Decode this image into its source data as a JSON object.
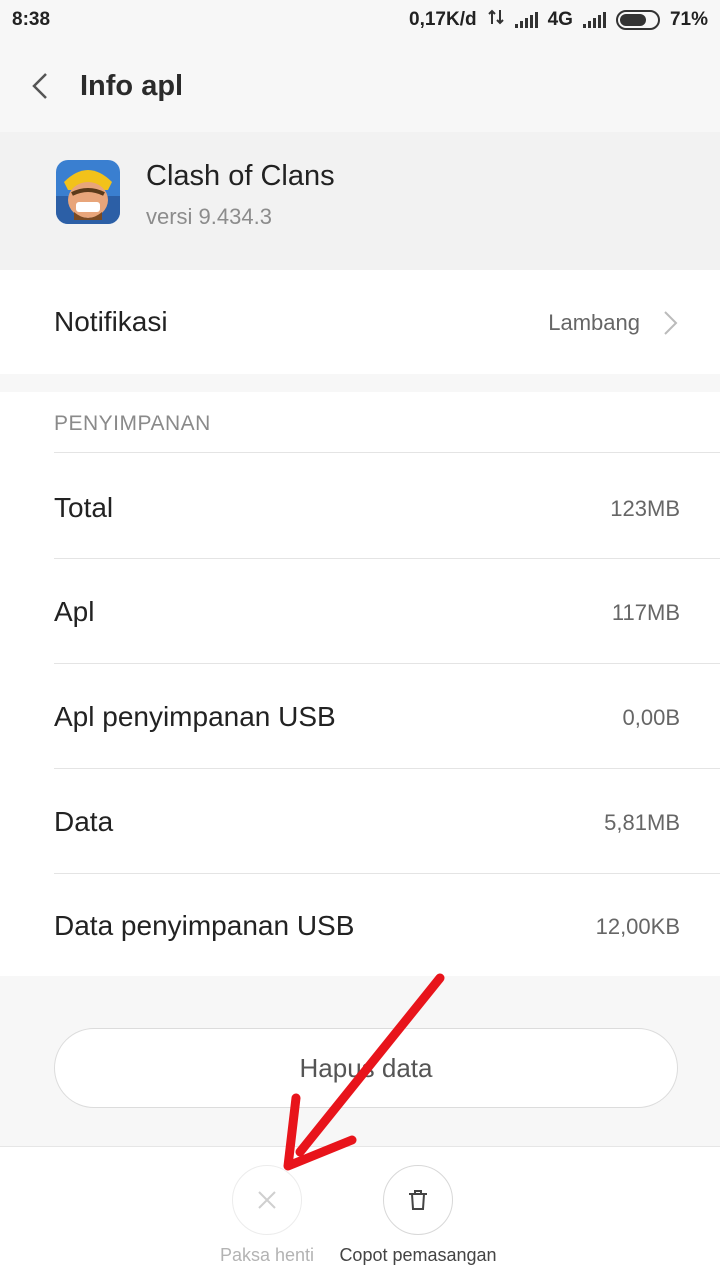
{
  "status_bar": {
    "time": "8:38",
    "net_speed": "0,17K/d",
    "network_type": "4G",
    "battery_percent": "71%",
    "battery_level": 0.71
  },
  "header": {
    "title": "Info apl",
    "back_icon": "chevron-left-icon"
  },
  "app": {
    "name": "Clash of Clans",
    "version": "versi 9.434.3"
  },
  "notification": {
    "label": "Notifikasi",
    "value": "Lambang"
  },
  "storage": {
    "heading": "PENYIMPANAN",
    "rows": [
      {
        "label": "Total",
        "value": "123MB"
      },
      {
        "label": "Apl",
        "value": "117MB"
      },
      {
        "label": "Apl penyimpanan USB",
        "value": "0,00B"
      },
      {
        "label": "Data",
        "value": "5,81MB"
      },
      {
        "label": "Data penyimpanan USB",
        "value": "12,00KB"
      }
    ]
  },
  "clear_data_button": {
    "label": "Hapus data"
  },
  "bottom_actions": [
    {
      "label": "Paksa henti",
      "icon": "close-icon",
      "enabled": false
    },
    {
      "label": "Copot pemasangan",
      "icon": "trash-icon",
      "enabled": true
    }
  ],
  "annotation": {
    "arrow_color": "#e8141b"
  }
}
